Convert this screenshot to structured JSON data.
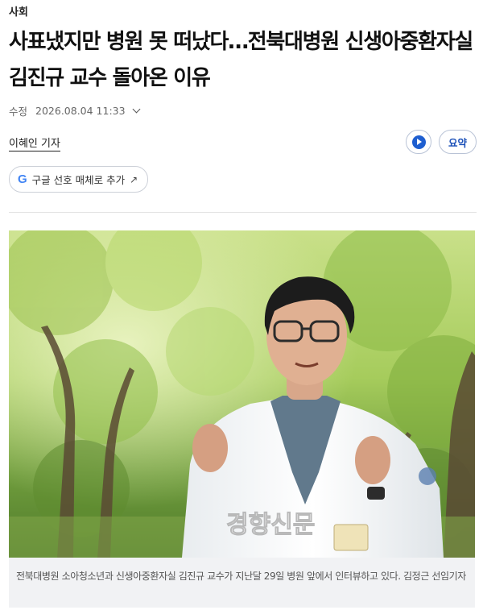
{
  "article": {
    "section": "사회",
    "headline": "사표냈지만 병원 못 떠났다…전북대병원 신생아중환자실 김진규 교수 돌아온 이유",
    "updated_label": "수정",
    "updated_time": "2026.08.04 11:33",
    "author": "이혜인 기자"
  },
  "actions": {
    "summary_label": "요약",
    "google_follow_label": "구글 선호 매체로 추가",
    "google_glyph": "G",
    "arrow_glyph": "↗"
  },
  "photo": {
    "watermark": "경향신문",
    "caption": "전북대병원 소아청소년과 신생아중환자실 김진규 교수가 지난달 29일 병원 앞에서 인터뷰하고 있다. 김정근 선임기자"
  },
  "colors": {
    "accent": "#1f5fd0"
  }
}
